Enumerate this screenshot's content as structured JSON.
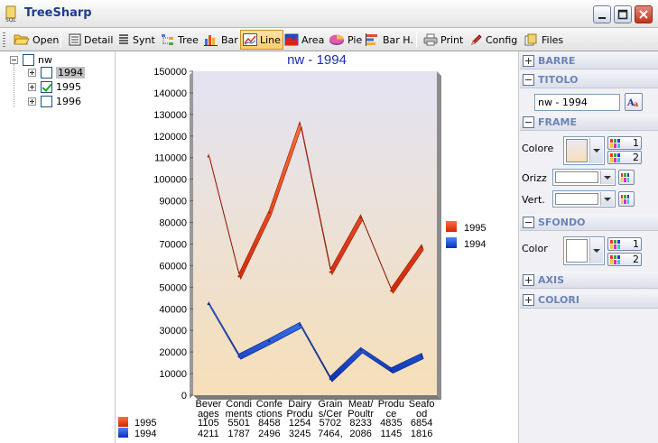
{
  "window": {
    "title": "TreeSharp"
  },
  "toolbar": {
    "open": "Open",
    "detail": "Detail",
    "synt": "Synt",
    "tree": "Tree",
    "bar": "Bar",
    "line": "Line",
    "area": "Area",
    "pie": "Pie",
    "barh": "Bar H.",
    "print": "Print",
    "config": "Config",
    "files": "Files"
  },
  "tree": {
    "root": "nw",
    "children": [
      {
        "label": "1994",
        "checked": false,
        "selected": true
      },
      {
        "label": "1995",
        "checked": true,
        "selected": false
      },
      {
        "label": "1996",
        "checked": false,
        "selected": false
      }
    ]
  },
  "panel": {
    "barre": "BARRE",
    "titolo": "TITOLO",
    "titolo_value": "nw - 1994",
    "frame": "FRAME",
    "colore": "Colore",
    "btn1": "1",
    "btn2": "2",
    "orizz": "Orizz",
    "vert": "Vert.",
    "sfondo": "SFONDO",
    "color": "Color",
    "axis": "AXIS",
    "colori": "COLORI"
  },
  "colors": {
    "series_1995": "#c0320c",
    "series_1994": "#0a36b5",
    "accent": "#ffcd6b",
    "section_title": "#6c83b8"
  },
  "chart_data": {
    "type": "line",
    "title": "nw - 1994",
    "categories": [
      "Beverages",
      "Condiments",
      "Confections",
      "Dairy Products",
      "Grains/Cereals",
      "Meat/Poultry",
      "Produce",
      "Seafood"
    ],
    "category_lines": [
      [
        "Bever",
        "ages"
      ],
      [
        "Condi",
        "ments"
      ],
      [
        "Confe",
        "ctions"
      ],
      [
        "Dairy",
        "Produ"
      ],
      [
        "Grain",
        "s/Cer"
      ],
      [
        "Meat/",
        "Poultr"
      ],
      [
        "Produ",
        "ce"
      ],
      [
        "Seafo",
        "od"
      ]
    ],
    "ylim": [
      0,
      150000
    ],
    "yticks": [
      0,
      10000,
      20000,
      30000,
      40000,
      50000,
      60000,
      70000,
      80000,
      90000,
      100000,
      110000,
      120000,
      130000,
      140000,
      150000
    ],
    "legend": [
      "1995",
      "1994"
    ],
    "legend_position": "right",
    "series": [
      {
        "name": "1995",
        "values": [
          110500,
          55010,
          84580,
          125400,
          57020,
          82330,
          48350,
          68540
        ],
        "table": [
          "1105",
          "5501",
          "8458",
          "1254",
          "5702",
          "8233",
          "4835",
          "6854"
        ]
      },
      {
        "name": "1994",
        "values": [
          42110,
          17870,
          24960,
          32450,
          7464,
          20860,
          11450,
          18160
        ],
        "table": [
          "4211",
          "1787",
          "2496",
          "3245",
          "7464,",
          "2086",
          "1145",
          "1816"
        ]
      }
    ]
  }
}
